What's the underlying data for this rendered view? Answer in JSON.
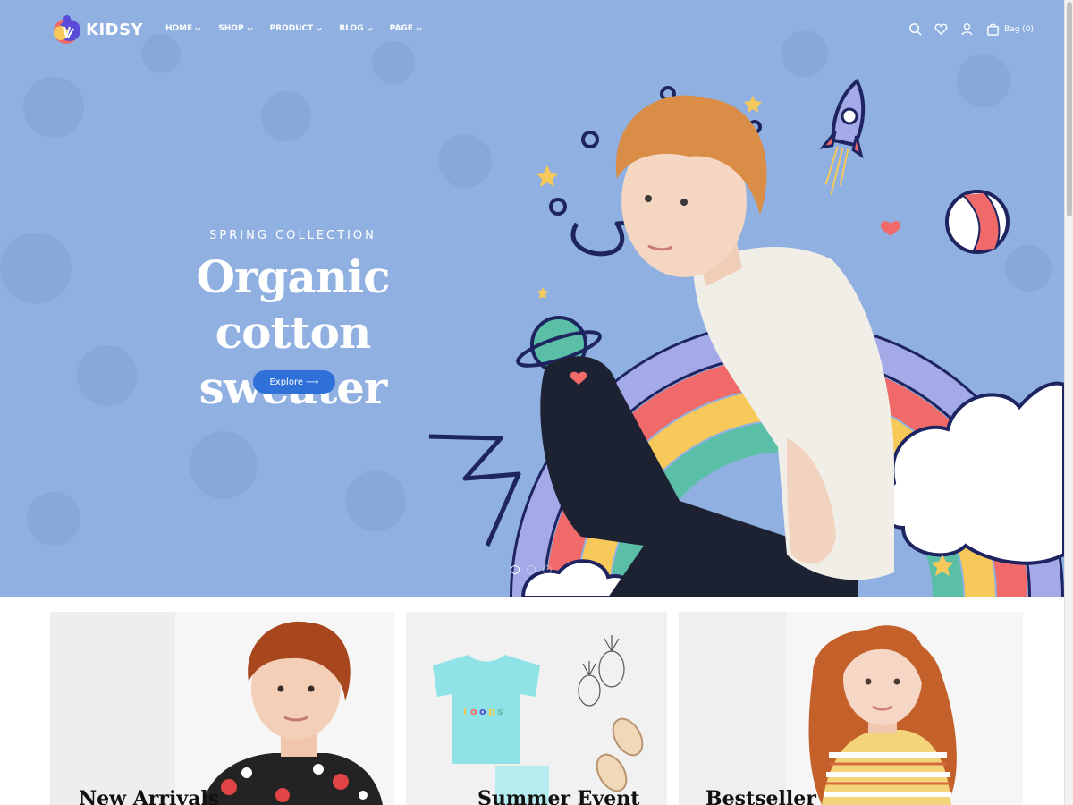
{
  "brand": {
    "name": "KIDSY"
  },
  "nav": {
    "items": [
      {
        "label": "HOME"
      },
      {
        "label": "SHOP"
      },
      {
        "label": "PRODUCT"
      },
      {
        "label": "BLOG"
      },
      {
        "label": "PAGE"
      }
    ]
  },
  "header": {
    "icons": [
      "search-icon",
      "heart-icon",
      "user-icon",
      "bag-icon"
    ],
    "bag_label": "Bag (0)"
  },
  "hero": {
    "subtitle": "SPRING COLLECTION",
    "title_line1": "Organic cotton",
    "title_line2": "sweater",
    "button_label": "Explore ⟶",
    "active_slide": 1,
    "slide_count": 3
  },
  "cards": [
    {
      "title": "New Arrivals"
    },
    {
      "title": "Summer Event"
    },
    {
      "title": "Bestseller"
    }
  ],
  "colors": {
    "hero_bg": "#8fb0e0",
    "accent": "#2f71d8",
    "rainbow": [
      "#a4aae8",
      "#f06a6a",
      "#f7c85a",
      "#5bbfa8"
    ]
  }
}
